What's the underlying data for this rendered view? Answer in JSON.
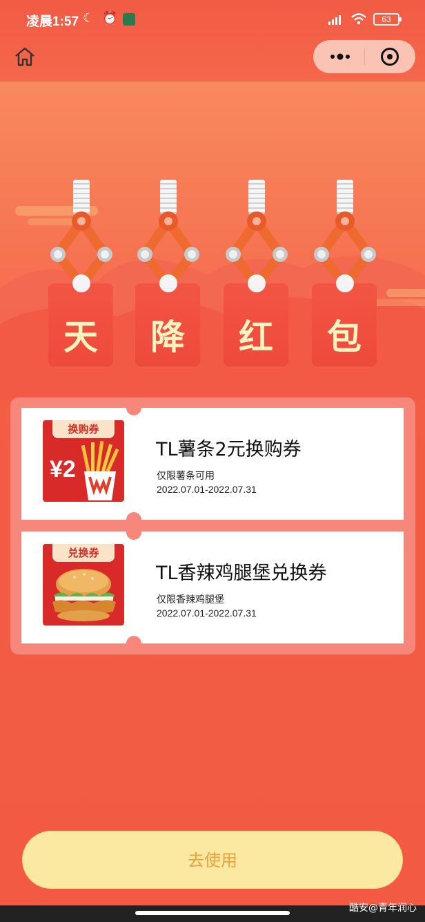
{
  "status_bar": {
    "time": "凌晨1:57",
    "battery": "63"
  },
  "nav": {
    "home_icon": "home-icon",
    "more_icon": "more-dots-icon",
    "close_icon": "target-icon"
  },
  "banner": {
    "chars": [
      "天",
      "降",
      "红",
      "包"
    ]
  },
  "coupons": [
    {
      "tag": "换购券",
      "title": "TL薯条2元换购券",
      "desc": "仅限薯条可用",
      "date": "2022.07.01-2022.07.31",
      "img_price": "¥2"
    },
    {
      "tag": "兑换券",
      "title": "TL香辣鸡腿堡兑换券",
      "desc": "仅限香辣鸡腿堡",
      "date": "2022.07.01-2022.07.31"
    }
  ],
  "action": {
    "use_label": "去使用"
  },
  "watermark": "酷安@青年润心",
  "colors": {
    "background": "#f05a44",
    "button_bg": "#fbe9a2",
    "button_text": "#e8a33b",
    "char_color": "#fff3c0"
  }
}
